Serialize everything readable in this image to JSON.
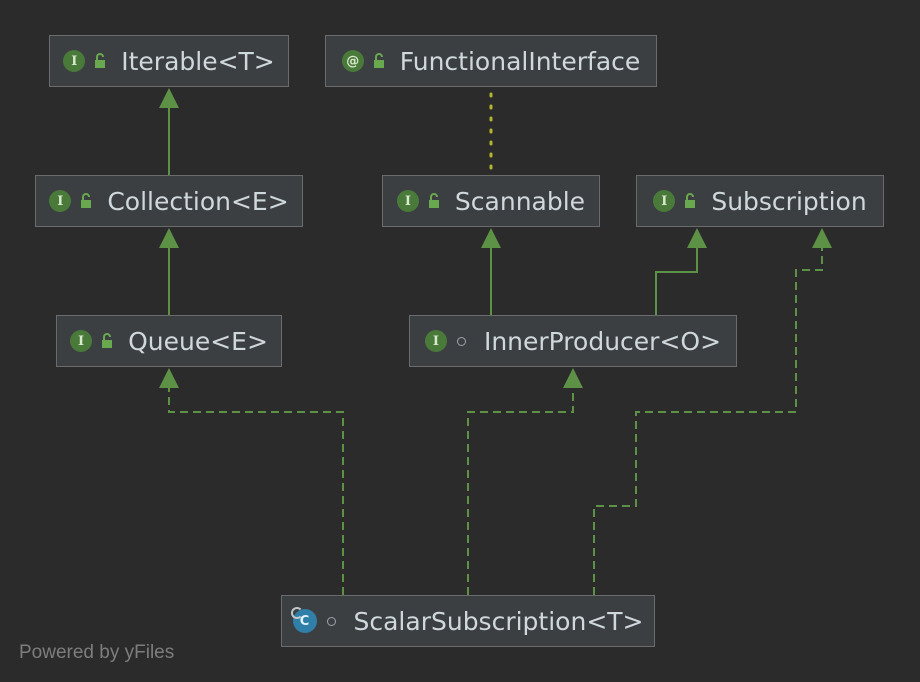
{
  "diagram": {
    "nodes": [
      {
        "id": "iterable",
        "badge": "I",
        "badge_type": "interface",
        "visibility_icon": "open-lock-icon",
        "label": "Iterable<T>"
      },
      {
        "id": "functional",
        "badge": "@",
        "badge_type": "annotation",
        "visibility_icon": "open-lock-icon",
        "label": "FunctionalInterface"
      },
      {
        "id": "collection",
        "badge": "I",
        "badge_type": "interface",
        "visibility_icon": "open-lock-icon",
        "label": "Collection<E>"
      },
      {
        "id": "scannable",
        "badge": "I",
        "badge_type": "interface",
        "visibility_icon": "open-lock-icon",
        "label": "Scannable"
      },
      {
        "id": "subscription",
        "badge": "I",
        "badge_type": "interface",
        "visibility_icon": "open-lock-icon",
        "label": "Subscription"
      },
      {
        "id": "queue",
        "badge": "I",
        "badge_type": "interface",
        "visibility_icon": "open-lock-icon",
        "label": "Queue<E>"
      },
      {
        "id": "innerproducer",
        "badge": "I",
        "badge_type": "interface",
        "visibility_icon": "package-private-icon",
        "label": "InnerProducer<O>"
      },
      {
        "id": "scalar",
        "badge": "C",
        "badge_type": "class",
        "visibility_icon": "package-private-icon",
        "label": "ScalarSubscription<T>"
      }
    ],
    "edges": [
      {
        "from": "collection",
        "to": "iterable",
        "kind": "extends"
      },
      {
        "from": "queue",
        "to": "collection",
        "kind": "extends"
      },
      {
        "from": "innerproducer",
        "to": "scannable",
        "kind": "extends"
      },
      {
        "from": "innerproducer",
        "to": "subscription",
        "kind": "extends"
      },
      {
        "from": "scannable",
        "to": "functional",
        "kind": "annotated-by"
      },
      {
        "from": "scalar",
        "to": "queue",
        "kind": "implements"
      },
      {
        "from": "scalar",
        "to": "innerproducer",
        "kind": "implements"
      },
      {
        "from": "scalar",
        "to": "subscription",
        "kind": "implements"
      }
    ]
  },
  "colors": {
    "background": "#2b2b2b",
    "node_fill": "#3c3f41",
    "node_border": "#6b6b6b",
    "edge": "#5d9146",
    "annotation_edge": "#b5b52a",
    "interface_badge": "#4a7a3a",
    "class_badge": "#2f7fa8",
    "text": "#cfd8dc"
  },
  "watermark": "Powered by yFiles"
}
